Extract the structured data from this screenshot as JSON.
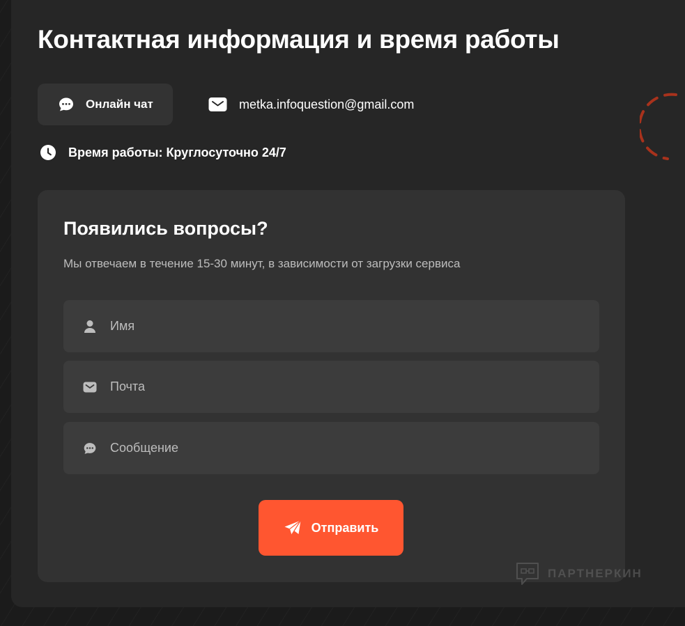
{
  "header": {
    "title": "Контактная информация и время работы"
  },
  "contacts": {
    "chat_label": "Онлайн чат",
    "email": "metka.infoquestion@gmail.com",
    "hours": "Время работы: Круглосуточно 24/7"
  },
  "form": {
    "title": "Появились вопросы?",
    "subtitle": "Мы отвечаем в течение 15-30 минут, в зависимости от загрузки сервиса",
    "name_placeholder": "Имя",
    "email_placeholder": "Почта",
    "message_placeholder": "Сообщение",
    "submit_label": "Отправить"
  },
  "watermark": {
    "text": "ПАРТНЕРКИН"
  },
  "icons": {
    "chat": "chat-bubble-icon",
    "email": "envelope-icon",
    "hours": "clock-icon",
    "name": "user-icon",
    "mail": "envelope-icon",
    "message": "chat-bubble-icon",
    "submit": "paper-plane-icon"
  },
  "colors": {
    "background": "#1b1b1b",
    "panel": "#262626",
    "card": "#323232",
    "field": "#3c3c3c",
    "accent": "#ff5630",
    "muted_text": "#bdbdbd"
  }
}
